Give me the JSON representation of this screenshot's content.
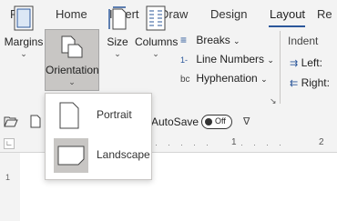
{
  "tabs": [
    "File",
    "Home",
    "Insert",
    "Draw",
    "Design",
    "Layout",
    "Re"
  ],
  "active_tab": "Layout",
  "ribbon": {
    "margins": "Margins",
    "orientation": "Orientation",
    "size": "Size",
    "columns": "Columns",
    "breaks": "Breaks",
    "line_numbers": "Line Numbers",
    "hyphenation": "Hyphenation",
    "indent": "Indent",
    "left": "Left:",
    "right": "Right:"
  },
  "qat": {
    "autosave": "AutoSave",
    "toggle": "Off"
  },
  "dropdown": {
    "portrait": "Portrait",
    "landscape": "Landscape"
  },
  "ruler": {
    "mark1": "1",
    "mark2": "2"
  },
  "colors": {
    "accent": "#2b579a",
    "selected_bg": "#c8c6c4",
    "ribbon_bg": "#f3f3f3"
  }
}
